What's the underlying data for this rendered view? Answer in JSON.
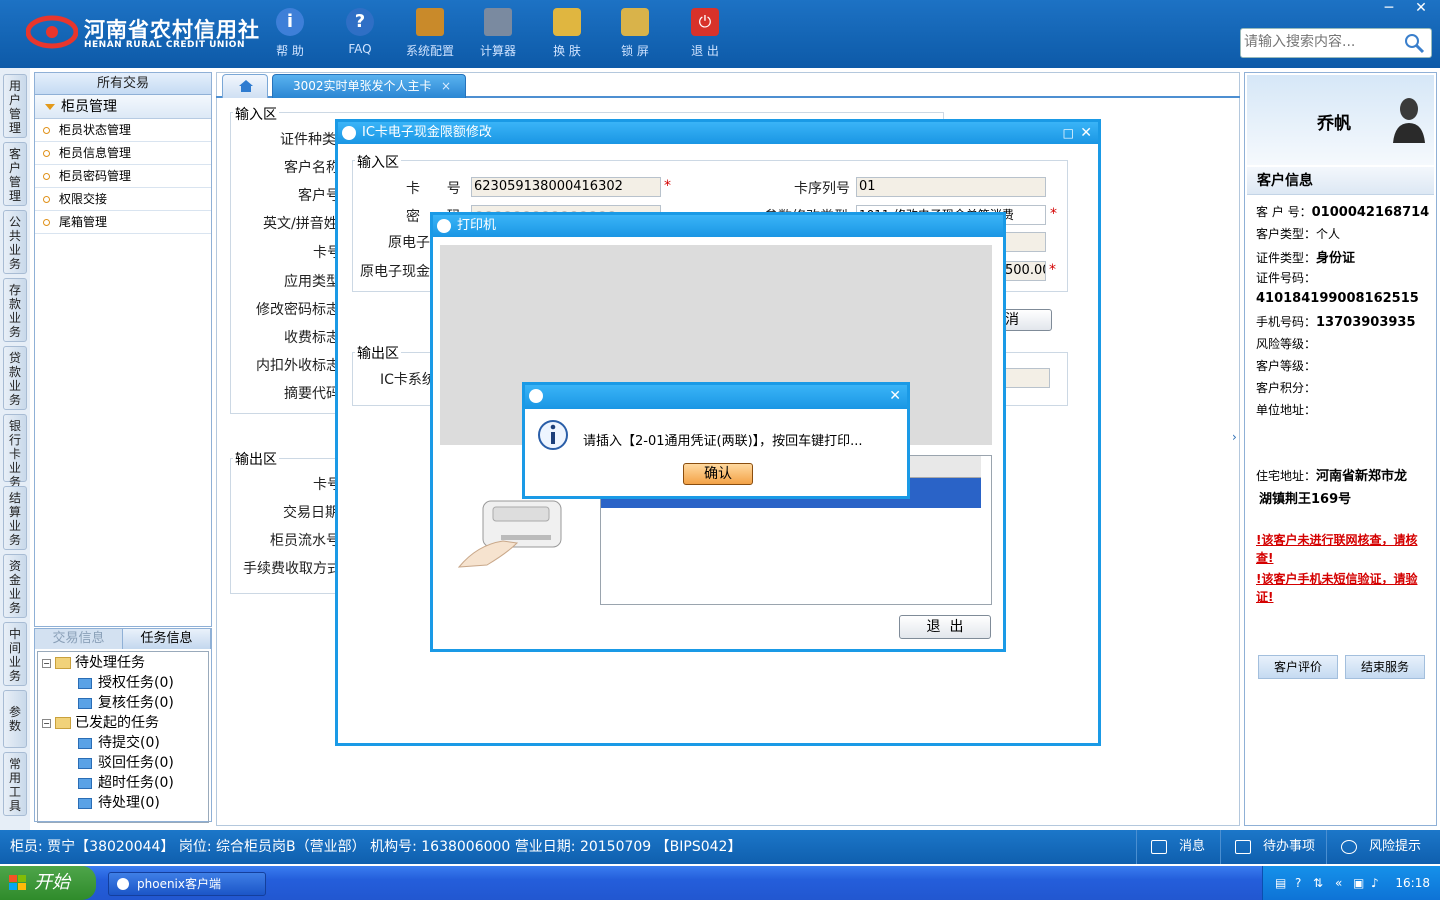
{
  "header": {
    "brand_cn": "河南省农村信用社",
    "brand_en": "HENAN RURAL CREDIT UNION",
    "tools": [
      {
        "label": "帮 助",
        "icon": "info-icon",
        "color": "#3e7fd8"
      },
      {
        "label": "FAQ",
        "icon": "question-icon",
        "color": "#2f6fc5"
      },
      {
        "label": "系统配置",
        "icon": "toolbox-icon",
        "color": "#c98a2a"
      },
      {
        "label": "计算器",
        "icon": "calculator-icon",
        "color": "#7a8aa0"
      },
      {
        "label": "换 肤",
        "icon": "shirt-icon",
        "color": "#e0b640"
      },
      {
        "label": "锁 屏",
        "icon": "lock-icon",
        "color": "#d9b34a"
      },
      {
        "label": "退 出",
        "icon": "power-icon",
        "color": "#d8322a"
      }
    ],
    "search_placeholder": "请输入搜索内容..."
  },
  "vnav": [
    "用户管理",
    "客户管理",
    "公共业务",
    "存款业务",
    "贷款业务",
    "银行卡业务",
    "结算业务",
    "资金业务",
    "中间业务",
    "参数",
    "常用工具"
  ],
  "left_panel": {
    "title": "所有交易",
    "group": "柜员管理",
    "items": [
      "柜员状态管理",
      "柜员信息管理",
      "柜员密码管理",
      "权限交接",
      "尾箱管理"
    ]
  },
  "task_panel": {
    "tabs": [
      "交易信息",
      "任务信息"
    ],
    "tree": {
      "pending": "待处理任务",
      "auth": "授权任务(0)",
      "review": "复核任务(0)",
      "initiated": "已发起的任务",
      "to_submit": "待提交(0)",
      "rejected": "驳回任务(0)",
      "timeout": "超时任务(0)",
      "to_process": "待处理(0)"
    }
  },
  "tabs": {
    "active": "3002实时单张发个人主卡"
  },
  "form_bg": {
    "input_legend": "输入区",
    "labels": [
      "证件种类",
      "客户名称",
      "客户号",
      "英文/拼音姓",
      "卡号",
      "应用类型",
      "修改密码标志",
      "收费标志",
      "内扣外收标志",
      "摘要代码"
    ],
    "output_legend": "输出区",
    "out_labels": [
      "卡号",
      "交易日期",
      "柜员流水号",
      "手续费收取方式"
    ]
  },
  "ic_dialog": {
    "title": "IC卡电子现金限额修改",
    "input_legend": "输入区",
    "card_no_label": "卡      号",
    "card_no": "623059138000416302",
    "pwd_label": "密      码",
    "orig_label": "原电子",
    "orig_cash_label": "原电子现金",
    "seq_label": "卡序列号",
    "seq_value": "01",
    "param_label": "参数修改类型",
    "param_value": "1011-修改电子现金单笔消费",
    "amount_value": "500.00",
    "cancel_fragment": "消",
    "output_legend": "输出区",
    "ic_sys_label": "IC卡系统"
  },
  "printer_dialog": {
    "title": "打印机",
    "exit_label": "退  出"
  },
  "msg_dialog": {
    "message": "请插入【2-01通用凭证(两联)】，按回车键打印...",
    "ok_label": "确认"
  },
  "right_panel": {
    "name": "乔帆",
    "section": "客户信息",
    "customer_no_label": "客 户 号：",
    "customer_no": "0100042168714",
    "type_label": "客户类型：",
    "type_value": "个人",
    "id_type_label": "证件类型：",
    "id_type_value": "身份证",
    "id_no_label": "证件号码：",
    "id_no_value": "410184199008162515",
    "phone_label": "手机号码：",
    "phone_value": "13703903935",
    "risk_label": "风险等级：",
    "level_label": "客户等级：",
    "points_label": "客户积分：",
    "company_label": "单位地址：",
    "home_label": "住宅地址：",
    "home_value_1": "河南省新郑市龙",
    "home_value_2": "湖镇荆王169号",
    "warn1": "!该客户未进行联网核查，请核查!",
    "warn2": "!该客户手机未短信验证，请验证!",
    "btn_eval": "客户评价",
    "btn_end": "结束服务"
  },
  "status": {
    "text": "柜员: 贾宁【38020044】 岗位: 综合柜员岗B（营业部）  机构号: 1638006000   营业日期: 20150709  【BIPS042】",
    "msg": "消息",
    "todo": "待办事项",
    "risk": "风险提示"
  },
  "taskbar": {
    "start": "开始",
    "app": "phoenix客户端",
    "clock": "16:18"
  }
}
